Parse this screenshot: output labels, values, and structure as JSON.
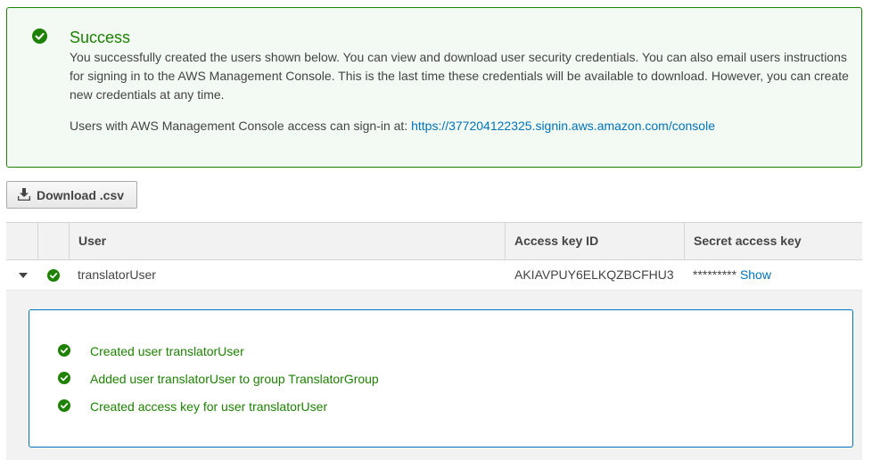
{
  "alert": {
    "title": "Success",
    "message": "You successfully created the users shown below. You can view and download user security credentials. You can also email users instructions for signing in to the AWS Management Console. This is the last time these credentials will be available to download. However, you can create new credentials at any time.",
    "signin_prefix": "Users with AWS Management Console access can sign-in at:",
    "signin_url": "https://377204122325.signin.aws.amazon.com/console",
    "icon": "check-circle-icon",
    "color": "#1d8102"
  },
  "toolbar": {
    "download_label": "Download .csv",
    "download_icon": "download-icon"
  },
  "table": {
    "headers": {
      "user": "User",
      "access_key_id": "Access key ID",
      "secret_access_key": "Secret access key"
    },
    "rows": [
      {
        "user": "translatorUser",
        "access_key_id": "AKIAVPUY6ELKQZBCFHU3",
        "secret_masked": "*********",
        "secret_action": "Show",
        "expanded": true
      }
    ]
  },
  "details": {
    "steps": [
      "Created user translatorUser",
      "Added user translatorUser to group TranslatorGroup",
      "Created access key for user translatorUser"
    ]
  },
  "colors": {
    "success": "#1d8102",
    "link": "#0073bb"
  }
}
